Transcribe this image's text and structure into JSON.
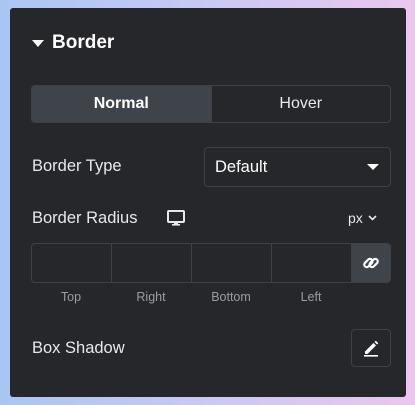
{
  "section": {
    "title": "Border",
    "icon": "caret-down-icon"
  },
  "tabs": [
    {
      "label": "Normal",
      "active": true
    },
    {
      "label": "Hover",
      "active": false
    }
  ],
  "border_type": {
    "label": "Border Type",
    "value": "Default"
  },
  "border_radius": {
    "label": "Border Radius",
    "device_icon": "monitor-icon",
    "unit": "px",
    "fields": [
      {
        "label": "Top",
        "value": ""
      },
      {
        "label": "Right",
        "value": ""
      },
      {
        "label": "Bottom",
        "value": ""
      },
      {
        "label": "Left",
        "value": ""
      }
    ],
    "link_icon": "link-icon"
  },
  "box_shadow": {
    "label": "Box Shadow",
    "edit_icon": "pencil-icon"
  },
  "colors": {
    "panel_bg": "#26272b",
    "control_border": "#3f4148",
    "active_bg": "#3f444b",
    "text": "#e6e8ea",
    "muted_text": "#9a9ca3"
  }
}
